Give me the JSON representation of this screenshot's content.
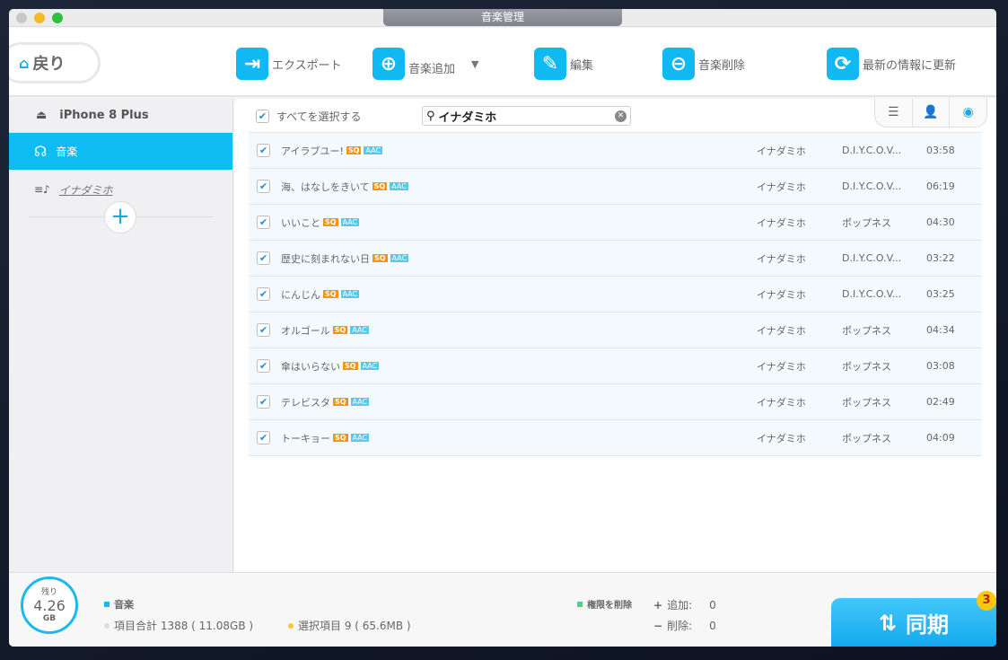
{
  "window": {
    "title": "音楽管理"
  },
  "toolbar": {
    "back": "戻り",
    "export": "エクスポート",
    "add_music": "音楽追加",
    "edit": "編集",
    "delete_music": "音楽削除",
    "refresh": "最新の情報に更新"
  },
  "sidebar": {
    "device": "iPhone 8 Plus",
    "music": "音楽",
    "playlist": "イナダミホ"
  },
  "list_header": {
    "select_all": "すべてを選択する",
    "search_value": "イナダミホ"
  },
  "badges": {
    "sq": "SQ",
    "aac": "AAC"
  },
  "songs": [
    {
      "title": "アイラブユー!",
      "artist": "イナダミホ",
      "album": "D.I.Y.C.O.V...",
      "duration": "03:58",
      "checked": true
    },
    {
      "title": "海、はなしをきいて",
      "artist": "イナダミホ",
      "album": "D.I.Y.C.O.V...",
      "duration": "06:19",
      "checked": true
    },
    {
      "title": "いいこと",
      "artist": "イナダミホ",
      "album": "ポップネス",
      "duration": "04:30",
      "checked": true
    },
    {
      "title": "歴史に刻まれない日",
      "artist": "イナダミホ",
      "album": "D.I.Y.C.O.V...",
      "duration": "03:22",
      "checked": true
    },
    {
      "title": "にんじん",
      "artist": "イナダミホ",
      "album": "D.I.Y.C.O.V...",
      "duration": "03:25",
      "checked": true
    },
    {
      "title": "オルゴール",
      "artist": "イナダミホ",
      "album": "ポップネス",
      "duration": "04:34",
      "checked": true
    },
    {
      "title": "傘はいらない",
      "artist": "イナダミホ",
      "album": "ポップネス",
      "duration": "03:08",
      "checked": true
    },
    {
      "title": "テレビスタ",
      "artist": "イナダミホ",
      "album": "ポップネス",
      "duration": "02:49",
      "checked": true
    },
    {
      "title": "トーキョー",
      "artist": "イナダミホ",
      "album": "ポップネス",
      "duration": "04:09",
      "checked": true
    }
  ],
  "storage": {
    "label": "残り",
    "value": "4.26",
    "unit": "GB"
  },
  "footer": {
    "category": "音楽",
    "total": "項目合計 1388 ( 11.08GB )",
    "selected": "選択項目 9 ( 65.6MB )",
    "remove_rights": "権限を削除",
    "add_label": "追加:",
    "add_count": "0",
    "delete_label": "削除:",
    "delete_count": "0",
    "sync": "同期",
    "sync_badge": "3"
  },
  "colors": {
    "accent": "#0ebcf1",
    "sq": "#f39312",
    "aac": "#57c8f0"
  }
}
